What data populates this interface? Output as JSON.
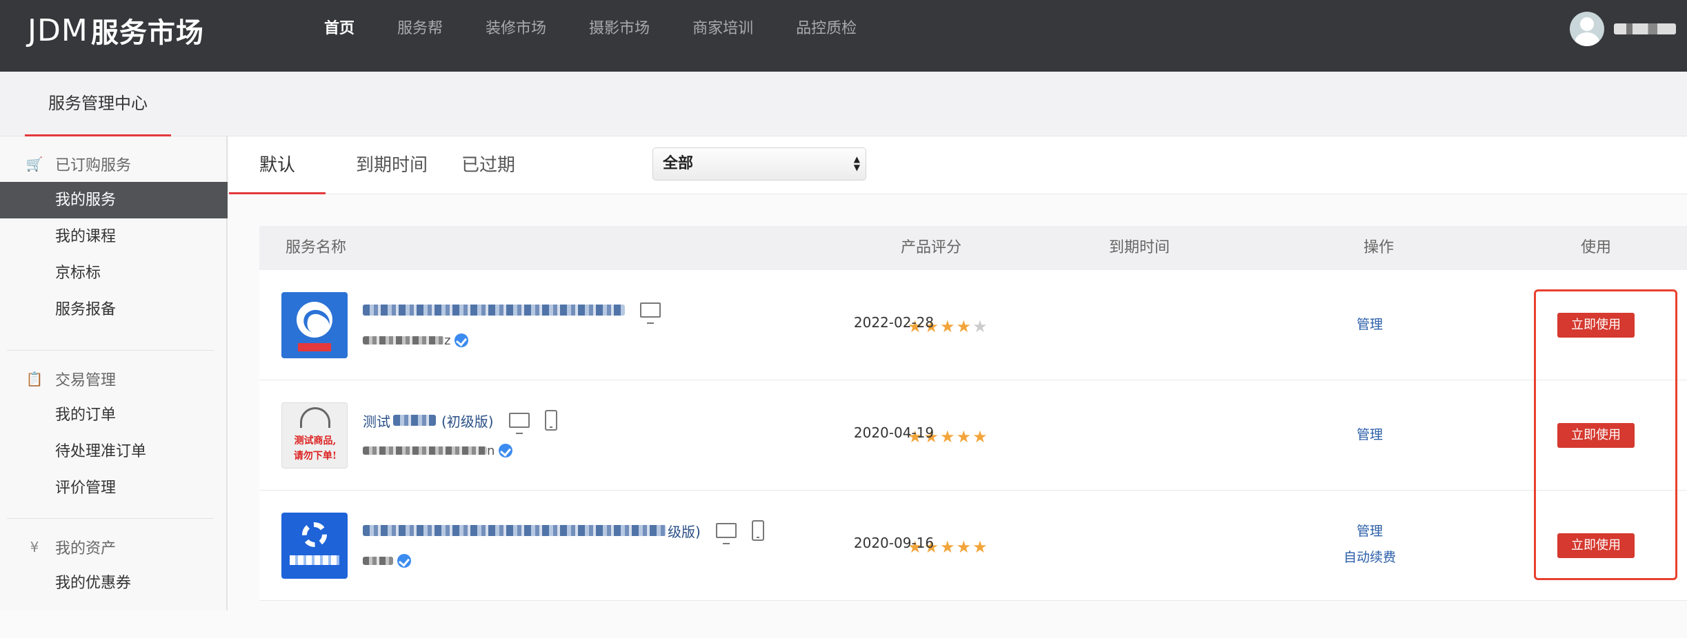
{
  "header": {
    "logo_mark": "JDM",
    "logo_text": "服务市场",
    "nav": [
      "首页",
      "服务帮",
      "装修市场",
      "摄影市场",
      "商家培训",
      "品控质检"
    ],
    "active_nav": "首页"
  },
  "subheader": {
    "title": "服务管理中心"
  },
  "sidebar": {
    "groups": [
      {
        "title": "已订购服务",
        "icon": "cart-icon",
        "items": [
          "我的服务",
          "我的课程",
          "京标标",
          "服务报备"
        ]
      },
      {
        "title": "交易管理",
        "icon": "clipboard-icon",
        "items": [
          "我的订单",
          "待处理准订单",
          "评价管理"
        ]
      },
      {
        "title": "我的资产",
        "icon": "yen-icon",
        "items": [
          "我的优惠券"
        ]
      }
    ],
    "active_item": "我的服务"
  },
  "tabs": [
    "默认",
    "到期时间",
    "已过期"
  ],
  "active_tab": "默认",
  "filter": {
    "selected": "全部"
  },
  "table": {
    "headers": [
      "服务名称",
      "产品评分",
      "到期时间",
      "操作",
      "使用"
    ],
    "rows": [
      {
        "name_suffix": "",
        "shop_suffix": "z",
        "rating": 4,
        "rating_max": 5,
        "expiry": "2022-02-28",
        "actions": [
          "管理"
        ],
        "use_label": "立即使用"
      },
      {
        "name_prefix": "测试",
        "name_suffix": "(初级版)",
        "shop_suffix": "n",
        "rating": 5,
        "rating_max": 5,
        "expiry": "2020-04-19",
        "actions": [
          "管理"
        ],
        "use_label": "立即使用"
      },
      {
        "name_suffix": "级版)",
        "shop_suffix": "",
        "rating": 5,
        "rating_max": 5,
        "expiry": "2020-09-16",
        "actions": [
          "管理",
          "自动续费"
        ],
        "use_label": "立即使用"
      }
    ],
    "thumb2_text": [
      "测试商品,",
      "请勿下单!"
    ]
  },
  "colors": {
    "topbar": "#37383c",
    "accent_red": "#e4393c",
    "button_red": "#d5392f",
    "link_blue": "#2a5ea8",
    "star": "#f2a53a"
  }
}
